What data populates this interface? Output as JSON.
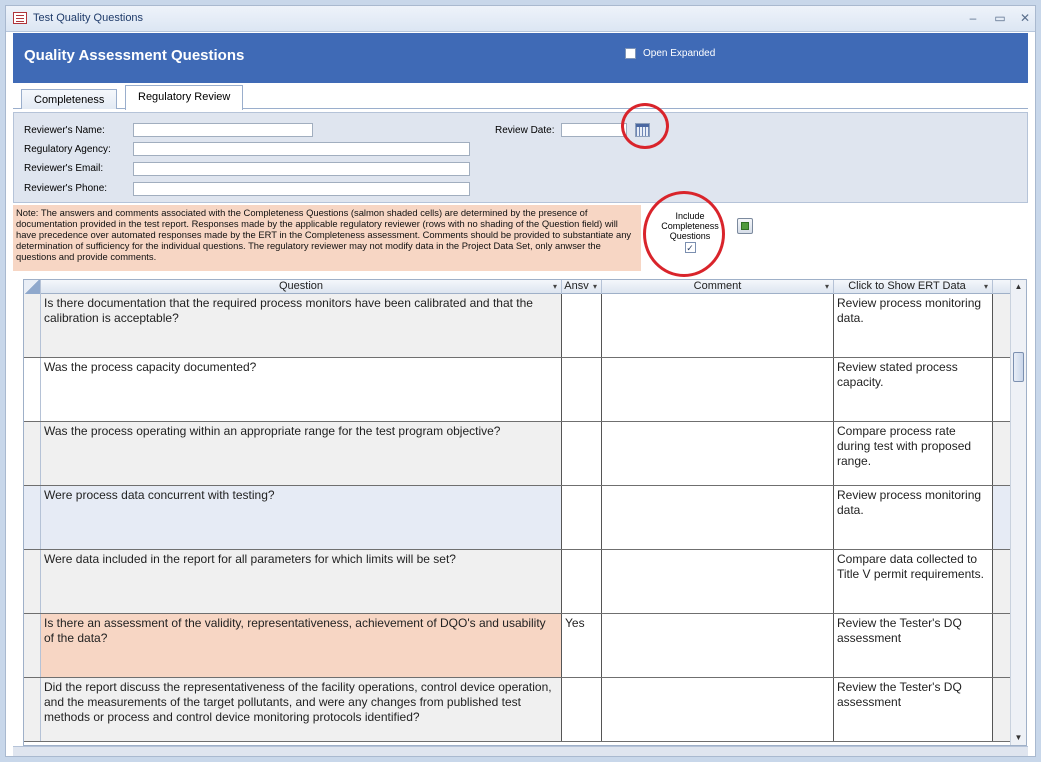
{
  "window": {
    "title": "Test Quality Questions"
  },
  "header": {
    "title": "Quality Assessment Questions",
    "open_expanded_label": "Open Expanded"
  },
  "tabs": [
    {
      "label": "Completeness",
      "active": false
    },
    {
      "label": "Regulatory Review",
      "active": true
    }
  ],
  "form": {
    "reviewer_name_label": "Reviewer's Name:",
    "reviewer_name_value": "",
    "agency_label": "Regulatory Agency:",
    "agency_value": "",
    "email_label": "Reviewer's Email:",
    "email_value": "",
    "phone_label": "Reviewer's Phone:",
    "phone_value": "",
    "review_date_label": "Review Date:",
    "review_date_value": ""
  },
  "note": "Note: The answers and comments associated with the Completeness Questions (salmon shaded cells) are determined by the presence of documentation provided in the test report. Responses made by the applicable regulatory reviewer (rows with no shading of the Question field) will have precedence over automated responses made by the ERT in the Completeness assessment. Comments should be provided to substantiate any determination of sufficiency for the individual questions.  The regulatory reviewer may not modify data in the Project Data Set, only anwser the questions and provide comments.",
  "include_completeness": {
    "label": "Include Completeness Questions",
    "checked": true,
    "check_glyph": "✓"
  },
  "grid": {
    "columns": [
      "Question",
      "Ansv",
      "Comment",
      "Click to Show ERT Data"
    ],
    "dropdown_glyph": "▾",
    "rows": [
      {
        "question": "Is there documentation that the required process monitors have been calibrated and that the calibration is acceptable?",
        "answer": "",
        "comment": "",
        "ert": "Review process monitoring data.",
        "shade": "gray"
      },
      {
        "question": "Was the process capacity documented?",
        "answer": "",
        "comment": "",
        "ert": "Review stated process capacity.",
        "shade": "white"
      },
      {
        "question": "Was the process operating within an appropriate range for the test program objective?",
        "answer": "",
        "comment": "",
        "ert": "Compare process rate during test with proposed range.",
        "shade": "gray"
      },
      {
        "question": "Were process data concurrent with testing?",
        "answer": "",
        "comment": "",
        "ert": "Review process monitoring data.",
        "shade": "blue"
      },
      {
        "question": "Were data included in the report for all parameters for which limits will be set?",
        "answer": "",
        "comment": "",
        "ert": "Compare data collected to Title V permit requirements.",
        "shade": "gray"
      },
      {
        "question": "Is there an assessment of the validity, representativeness, achievement of DQO's and usability of the data?",
        "answer": "Yes",
        "comment": "",
        "ert": "Review the Tester's DQ assessment",
        "shade": "salmon"
      },
      {
        "question": "Did the report discuss the representativeness of the facility operations, control device operation, and the measurements of the target pollutants, and were any changes from published test methods or process and control device monitoring protocols identified?",
        "answer": "",
        "comment": "",
        "ert": "Review the Tester's DQ assessment",
        "shade": "gray"
      }
    ]
  },
  "icons": {
    "app": "form-icon",
    "calendar": "calendar-icon",
    "refresh": "refresh-icon"
  },
  "colors": {
    "header": "#3f6ab6",
    "salmon": "#f7d6c4",
    "annotation": "#d9242b"
  }
}
